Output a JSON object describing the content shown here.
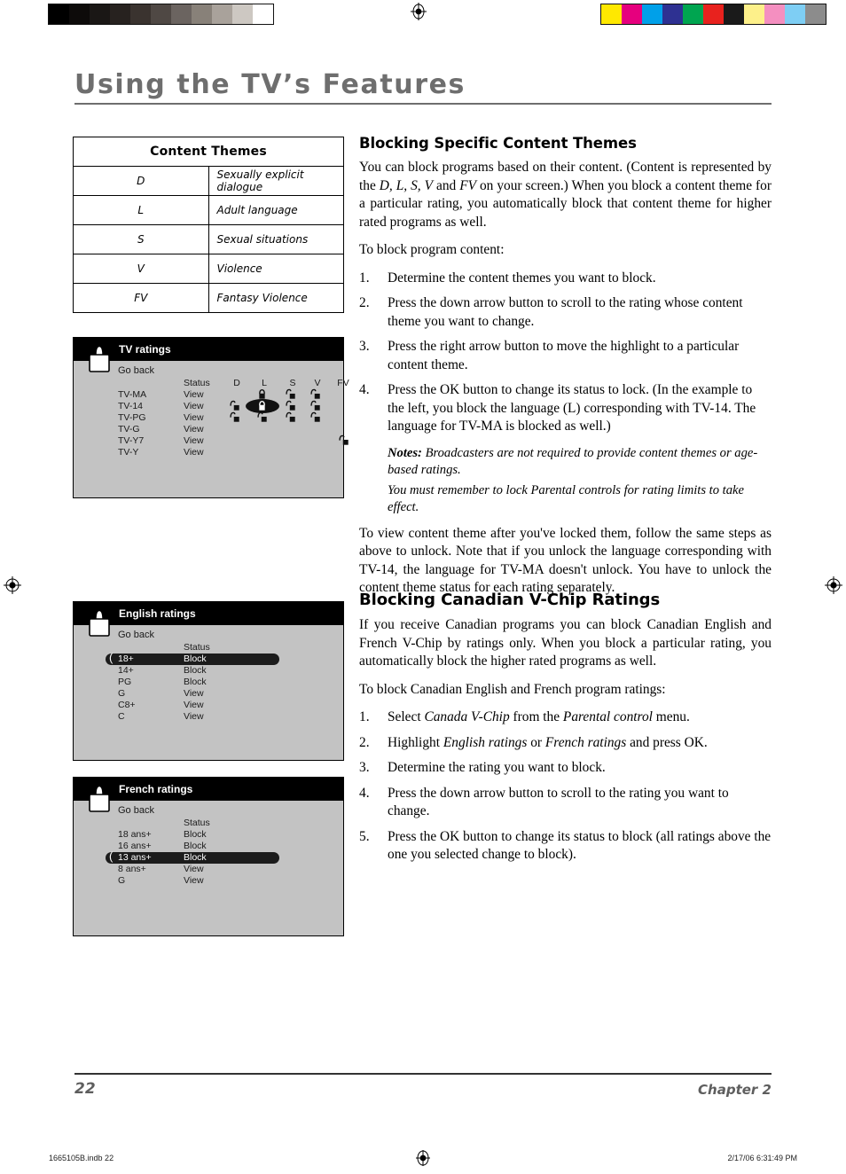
{
  "page": {
    "title": "Using the TV’s Features",
    "footer_page_number": "22",
    "footer_chapter": "Chapter 2",
    "print_file": "1665105B.indb   22",
    "print_timestamp": "2/17/06   6:31:49 PM"
  },
  "calibration": {
    "gray_bar": [
      "#000000",
      "#0d0b0a",
      "#1a1715",
      "#27221f",
      "#3a332f",
      "#4f4844",
      "#6b6460",
      "#888179",
      "#a9a29b",
      "#cdc8c2",
      "#ffffff"
    ],
    "color_bar": [
      "#ffe800",
      "#e6007e",
      "#00a0e9",
      "#2e3192",
      "#00a550",
      "#e8221e",
      "#1a1a1a",
      "#fdf08a",
      "#f48fc0",
      "#7ecef4",
      "#8c8c8c"
    ]
  },
  "content_themes_table": {
    "header": "Content Themes",
    "rows": [
      {
        "code": "D",
        "description": "Sexually explicit dialogue"
      },
      {
        "code": "L",
        "description": "Adult language"
      },
      {
        "code": "S",
        "description": "Sexual situations"
      },
      {
        "code": "V",
        "description": "Violence"
      },
      {
        "code": "FV",
        "description": "Fantasy Violence"
      }
    ]
  },
  "tv_ratings_screen": {
    "title": "TV ratings",
    "go_back": "Go back",
    "status_header": "Status",
    "theme_columns": [
      "D",
      "L",
      "S",
      "V",
      "FV"
    ],
    "rows": [
      {
        "label": "TV-MA",
        "status": "View",
        "locks": {
          "D": "none",
          "L": "closed",
          "S": "open",
          "V": "open",
          "FV": "none"
        }
      },
      {
        "label": "TV-14",
        "status": "View",
        "locks": {
          "D": "open",
          "L": "closed-selected",
          "S": "open",
          "V": "open",
          "FV": "none"
        }
      },
      {
        "label": "TV-PG",
        "status": "View",
        "locks": {
          "D": "open",
          "L": "open",
          "S": "open",
          "V": "open",
          "FV": "none"
        }
      },
      {
        "label": "TV-G",
        "status": "View",
        "locks": {
          "D": "none",
          "L": "none",
          "S": "none",
          "V": "none",
          "FV": "none"
        }
      },
      {
        "label": "TV-Y7",
        "status": "View",
        "locks": {
          "D": "none",
          "L": "none",
          "S": "none",
          "V": "none",
          "FV": "open"
        }
      },
      {
        "label": "TV-Y",
        "status": "View",
        "locks": {
          "D": "none",
          "L": "none",
          "S": "none",
          "V": "none",
          "FV": "none"
        }
      }
    ]
  },
  "english_ratings_screen": {
    "title": "English ratings",
    "go_back": "Go back",
    "status_header": "Status",
    "rows": [
      {
        "label": "18+",
        "status": "Block",
        "selected": true
      },
      {
        "label": "14+",
        "status": "Block",
        "selected": false
      },
      {
        "label": "PG",
        "status": "Block",
        "selected": false
      },
      {
        "label": "G",
        "status": "View",
        "selected": false
      },
      {
        "label": "C8+",
        "status": "View",
        "selected": false
      },
      {
        "label": "C",
        "status": "View",
        "selected": false
      }
    ]
  },
  "french_ratings_screen": {
    "title": "French ratings",
    "go_back": "Go back",
    "status_header": "Status",
    "rows": [
      {
        "label": "18 ans+",
        "status": "Block",
        "selected": false
      },
      {
        "label": "16 ans+",
        "status": "Block",
        "selected": false
      },
      {
        "label": "13 ans+",
        "status": "Block",
        "selected": true
      },
      {
        "label": "8 ans+",
        "status": "View",
        "selected": false
      },
      {
        "label": "G",
        "status": "View",
        "selected": false
      }
    ]
  },
  "section_content_themes": {
    "heading": "Blocking Specific Content Themes",
    "intro": "You can block programs based on their content. (Content is represented by the D, L, S, V and FV on your screen.) When you block a content theme for a particular rating, you automatically block that content theme for higher rated programs as well.",
    "lead_in": "To block program content:",
    "steps": [
      {
        "num": "1.",
        "text": "Determine the content themes you want to block."
      },
      {
        "num": "2.",
        "text": "Press the down arrow button to scroll to the rating whose content theme you want to change."
      },
      {
        "num": "3.",
        "text": "Press the right arrow button to move the highlight to a particular content theme."
      },
      {
        "num": "4.",
        "text": "Press the OK button to change its status to lock. (In the example to the left, you block the language (L) corresponding with TV-14. The language for TV-MA is blocked as well.)"
      }
    ],
    "note_label": "Notes:",
    "note_text": "Broadcasters are not required to provide content themes or age-based ratings.",
    "note_text_2": "You must remember to lock Parental controls for rating limits to take effect.",
    "closing": "To view content theme after you've locked them, follow the same steps as above to unlock. Note that if you unlock the language corresponding with TV-14, the language for TV-MA doesn't unlock. You have to unlock the content theme status for each rating separately."
  },
  "section_canadian": {
    "heading": "Blocking Canadian V-Chip Ratings",
    "intro": "If you receive Canadian programs you can block Canadian English and French V-Chip by ratings only. When you block a particular rating, you automatically block the higher rated programs as well.",
    "lead_in": "To block Canadian English and French program ratings:",
    "steps": [
      {
        "num": "1.",
        "text": "Select Canada V-Chip from the Parental control menu."
      },
      {
        "num": "2.",
        "text": "Highlight English ratings or French ratings and press OK."
      },
      {
        "num": "3.",
        "text": "Determine the rating you want to block."
      },
      {
        "num": "4.",
        "text": "Press the down arrow button to scroll to the rating you want to change."
      },
      {
        "num": "5.",
        "text": "Press the OK button to change its status to block (all ratings above the one you selected change to block)."
      }
    ]
  }
}
